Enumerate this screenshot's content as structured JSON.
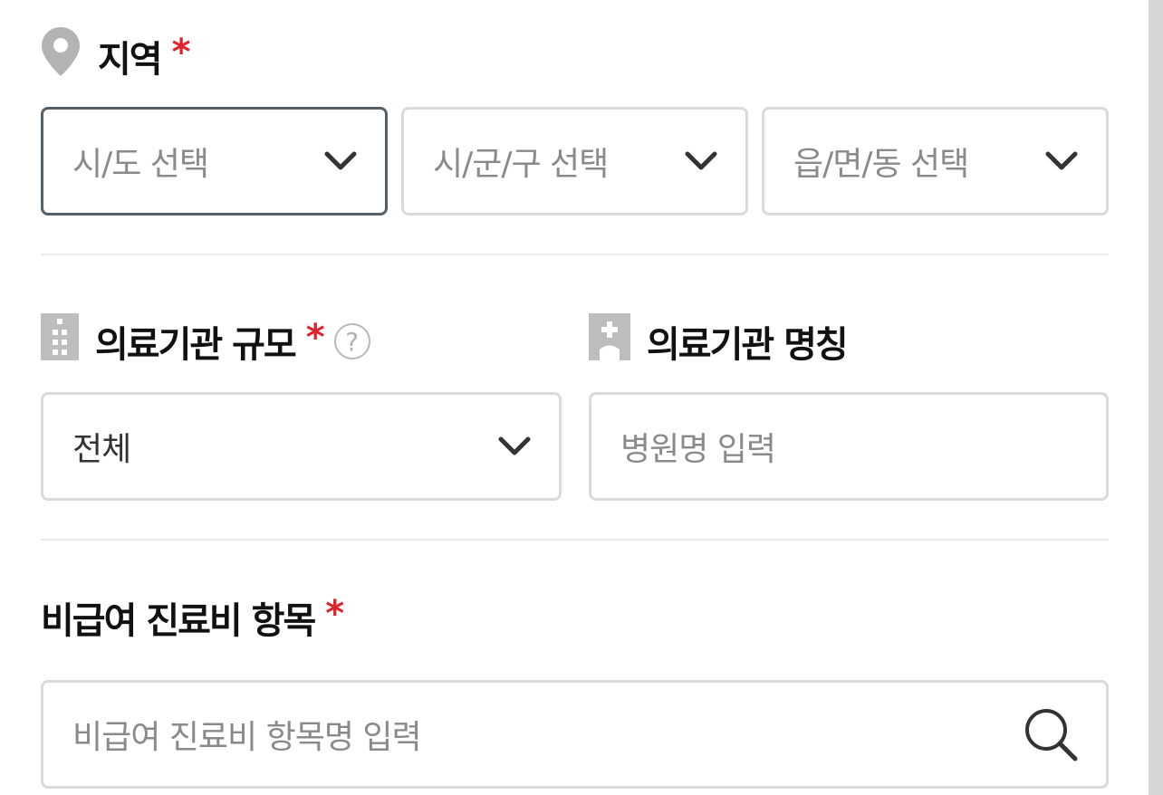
{
  "region": {
    "label": "지역",
    "required": "*",
    "sido_placeholder": "시/도 선택",
    "sigungu_placeholder": "시/군/구 선택",
    "dong_placeholder": "읍/면/동 선택"
  },
  "facility_size": {
    "label": "의료기관 규모",
    "required": "*",
    "help": "?",
    "selected": "전체"
  },
  "facility_name": {
    "label": "의료기관 명칭",
    "placeholder": "병원명 입력"
  },
  "noncovered_item": {
    "label": "비급여 진료비 항목",
    "required": "*",
    "placeholder": "비급여 진료비 항목명 입력"
  },
  "icons": {
    "region": "map-pin-icon",
    "facility_size": "building-icon",
    "facility_name": "hospital-icon",
    "dropdown": "chevron-down-icon",
    "search": "search-icon"
  },
  "colors": {
    "required_mark": "#e0222a",
    "focus_border": "#566069",
    "border": "#dadada"
  }
}
